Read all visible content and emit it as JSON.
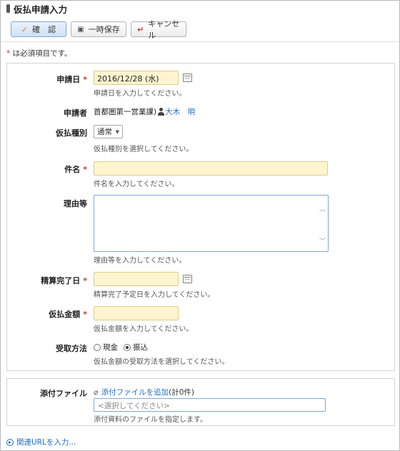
{
  "page": {
    "title": "仮払申請入力"
  },
  "toolbar": {
    "confirm_label": "確　認",
    "save_label": "一時保存",
    "cancel_label": "キャンセル"
  },
  "required_note": "は必須項目です。",
  "form": {
    "application_date": {
      "label": "申請日",
      "value": "2016/12/28 (水)",
      "hint": "申請日を入力してください。"
    },
    "applicant": {
      "label": "申請者",
      "department": "首都圏第一営業課)",
      "name": "大木　明"
    },
    "payment_type": {
      "label": "仮払種別",
      "value": "通常",
      "hint": "仮払種別を選択してください。"
    },
    "subject": {
      "label": "件名",
      "value": "",
      "hint": "件名を入力してください。"
    },
    "reason": {
      "label": "理由等",
      "value": "",
      "hint": "理由等を入力してください。"
    },
    "settlement_date": {
      "label": "精算完了日",
      "value": "",
      "hint": "精算完了予定日を入力してください。"
    },
    "amount": {
      "label": "仮払金額",
      "value": "",
      "hint": "仮払金額を入力してください。"
    },
    "receive_method": {
      "label": "受取方法",
      "options": [
        "現金",
        "振込"
      ],
      "selected": "振込",
      "hint": "仮払金額の受取方法を選択してください。"
    }
  },
  "attachments": {
    "label": "添付ファイル",
    "add_link": "添付ファイルを追加",
    "count_text": "(計0件)",
    "placeholder": "<選択してください>",
    "hint": "添付資料のファイルを指定します。"
  },
  "related_url_link": "関連URLを入力..."
}
